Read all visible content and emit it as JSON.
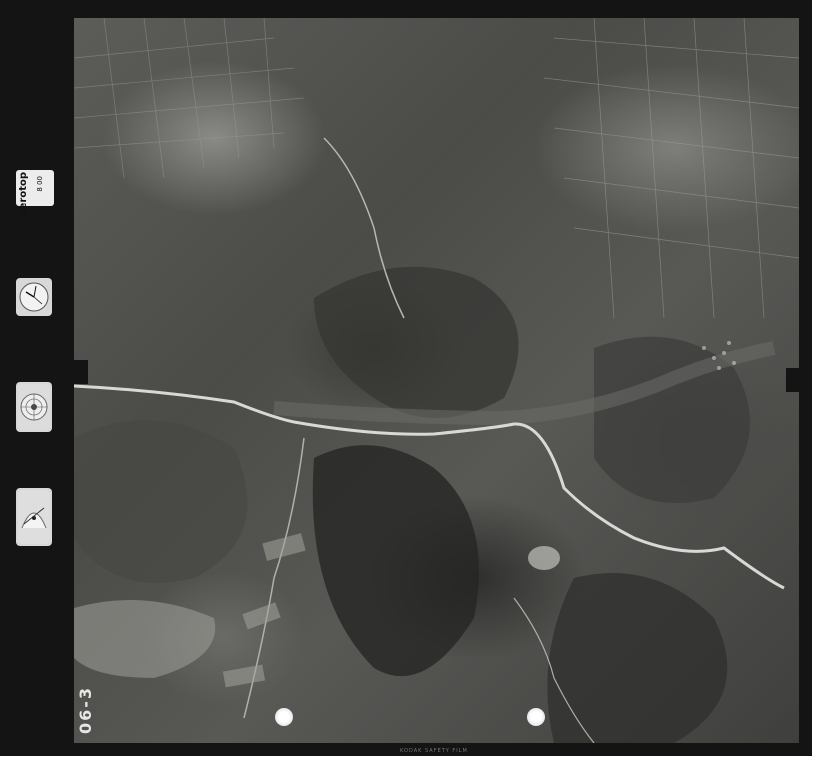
{
  "side_panel": {
    "logo_text": "aerotop",
    "logo_code": "8 00"
  },
  "frame_id": "06-3",
  "film_edge_note": "KODAK SAFETY FILM",
  "colors": {
    "border": "#141414",
    "road": "#d8d8d4",
    "terrain_dark": "#2e2e2c",
    "terrain_light": "#8a8a86"
  },
  "icons": [
    "clock-icon",
    "altimeter-icon",
    "level-icon",
    "fiducial-mark-icon"
  ]
}
